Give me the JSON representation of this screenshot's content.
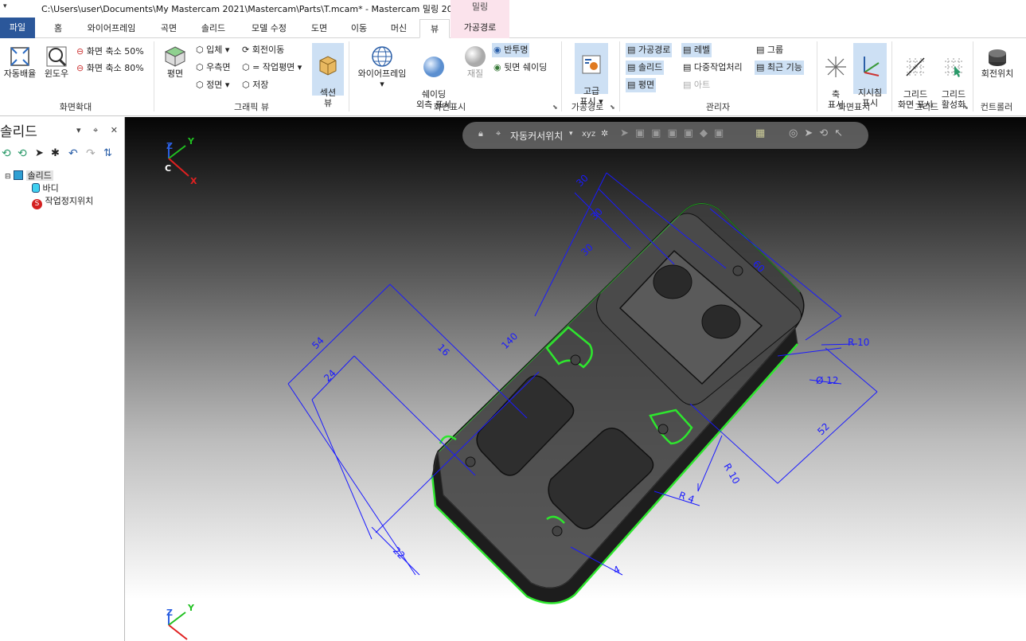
{
  "titlebar": {
    "quick_access": "▾",
    "title": "C:\\Users\\user\\Documents\\My Mastercam 2021\\Mastercam\\Parts\\T.mcam* - Mastercam 밀링 2021",
    "context_header": "밀링"
  },
  "tabs": {
    "file": "파일",
    "home": "홈",
    "wireframe": "와이어프레임",
    "surfaces": "곡면",
    "solids": "솔리드",
    "model_prep": "모델 수정",
    "drafting": "도면",
    "transform": "이동",
    "machine": "머신",
    "view": "뷰",
    "toolpaths": "가공경로"
  },
  "ribbon": {
    "zoom": {
      "fit": "자동배율",
      "window": "윈도우",
      "unzoom50": "화면 축소 50%",
      "unzoom80": "화면 축소 80%",
      "label": "화면확대"
    },
    "graphics_view": {
      "top": "평면",
      "iso": "입체",
      "right": "우측면",
      "front": "정면",
      "rotate_pan": "회전이동",
      "equal_plane": "= 작업평면",
      "save": "저장",
      "section_view": "섹션\n뷰",
      "label": "그래픽 뷰"
    },
    "appearance": {
      "wireframe": "와이어프레임",
      "shading": "쉐이딩\n외측 표시",
      "material": "재질",
      "translucency": "반투명",
      "backside": "뒷면 쉐이딩",
      "label": "화면표시"
    },
    "toolpaths": {
      "advanced": "고급\n표시",
      "label": "가공경로"
    },
    "managers": {
      "toolpaths": "가공경로",
      "levels": "레벨",
      "groups": "그룹",
      "solids": "솔리드",
      "multi_thread": "다중작업처리",
      "recent": "최근 기능",
      "planes": "평면",
      "art": "아트",
      "label": "관리자"
    },
    "display": {
      "axes": "축\n표시",
      "gnomons": "지시침\n표시",
      "label": "화면표시"
    },
    "grid": {
      "show": "그리드\n화면 표시",
      "snap": "그리드\n활성화",
      "label": "그리드"
    },
    "controller": {
      "rotate": "회전위치",
      "label": "컨트롤러"
    }
  },
  "panel": {
    "title": "솔리드",
    "buttons": "▾ ⌖ ✕",
    "tree": {
      "root": "솔리드",
      "body": "바디",
      "stop": "작업정지위치"
    }
  },
  "viewport": {
    "toolbar_label": "자동커서위치",
    "gnomon_top": {
      "z": "Z",
      "y": "Y",
      "x": "X",
      "c": "C"
    },
    "gnomon_bottom": {
      "z": "Z",
      "y": "Y"
    },
    "dimensions": {
      "d54": "54",
      "d24": "24",
      "d16": "16",
      "d140": "140",
      "d22": "22",
      "d60": "60",
      "dR10a": "R 10",
      "dDia12": "Ø 12",
      "d52": "52",
      "dR10b": "R 10",
      "dR4": "R 4",
      "d4": "4",
      "d30a": "30",
      "d30b": "30",
      "d30c": "30"
    }
  },
  "colors": {
    "file_tab": "#2b579a",
    "context_tab": "#fbe3ec",
    "select": "#cde0f4",
    "dimension": "#1a1aff",
    "edge": "#2ee62e"
  }
}
